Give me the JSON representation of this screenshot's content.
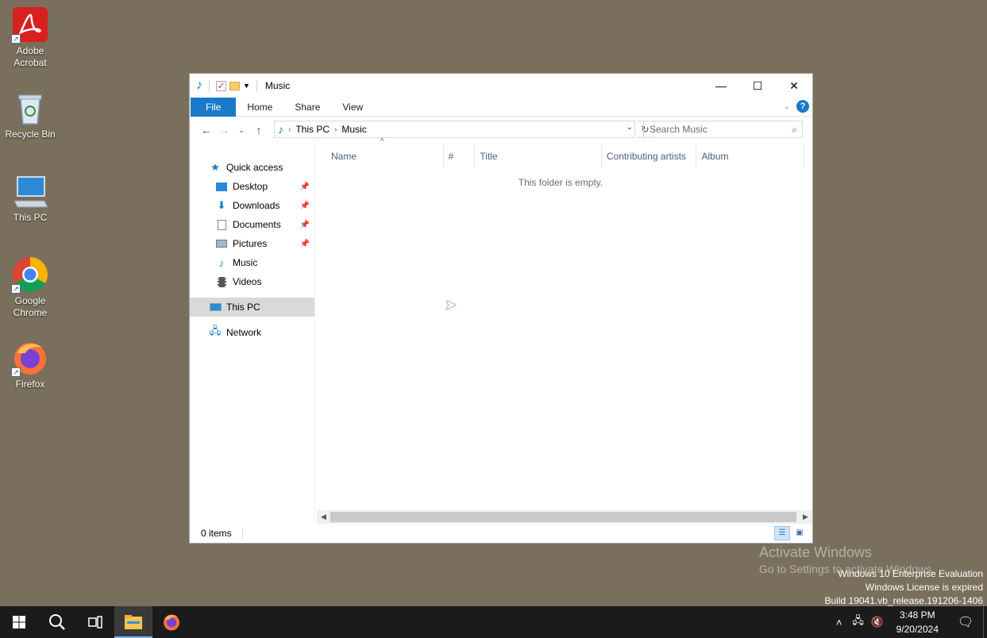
{
  "desktop": {
    "icons": [
      {
        "label": "Adobe\nAcrobat",
        "line1": "Adobe",
        "line2": "Acrobat",
        "icon": "adobe-acrobat-icon"
      },
      {
        "label": "Recycle Bin",
        "icon": "recycle-bin-icon"
      },
      {
        "label": "This PC",
        "icon": "this-pc-icon"
      },
      {
        "label": "Google Chrome",
        "line1": "Google",
        "line2": "Chrome",
        "icon": "chrome-icon"
      },
      {
        "label": "Firefox",
        "icon": "firefox-icon"
      }
    ]
  },
  "window": {
    "title": "Music",
    "controls": {
      "minimize": "—",
      "maximize": "☐",
      "close": "✕"
    },
    "ribbon": {
      "tabs": [
        "File",
        "Home",
        "Share",
        "View"
      ],
      "help": "?"
    },
    "address": {
      "crumbs": [
        "This PC",
        "Music"
      ]
    },
    "search": {
      "placeholder": "Search Music"
    },
    "nav": {
      "quick_access": "Quick access",
      "items": [
        "Desktop",
        "Downloads",
        "Documents",
        "Pictures",
        "Music",
        "Videos"
      ],
      "this_pc": "This PC",
      "network": "Network"
    },
    "columns": [
      "Name",
      "#",
      "Title",
      "Contributing artists",
      "Album"
    ],
    "empty_message": "This folder is empty.",
    "status": {
      "items": "0 items"
    }
  },
  "watermark": {
    "line1": "Activate Windows",
    "line2": "Go to Settings to activate Windows."
  },
  "eval_info": {
    "line1": "Windows 10 Enterprise Evaluation",
    "line2": "Windows License is expired",
    "line3": "Build 19041.vb_release.191206-1406"
  },
  "taskbar": {
    "clock_time": "3:48 PM",
    "clock_date": "9/20/2024"
  },
  "colors": {
    "desktop": "#7a6f5c",
    "accent": "#1979ca",
    "taskbar": "#1b1b1b"
  }
}
